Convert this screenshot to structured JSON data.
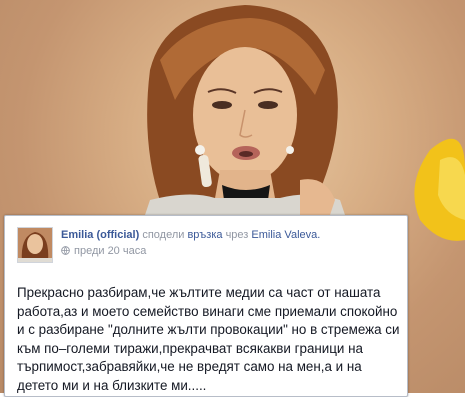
{
  "post": {
    "author_name": "Emilia (official)",
    "shared_text": "сподели",
    "link_text": "връзка",
    "via_text": "чрез",
    "via_name": "Emilia Valeva.",
    "timestamp": "преди 20 часа",
    "body": "Прекрасно разбирам,че жълтите медии са част от нашата работа,аз и моето семейство винаги сме приемали спокойно и с разбиране \"долните жълти провокации\" но в стремежа си към по–големи тиражи,прекрачват всякакви граници на търпимост,забравяйки,че не вредят само на мен,а и на детето ми и на близките ми....."
  },
  "colors": {
    "link": "#3b5998",
    "meta": "#9197a3",
    "text": "#141823"
  },
  "icons": {
    "privacy": "globe-icon"
  }
}
